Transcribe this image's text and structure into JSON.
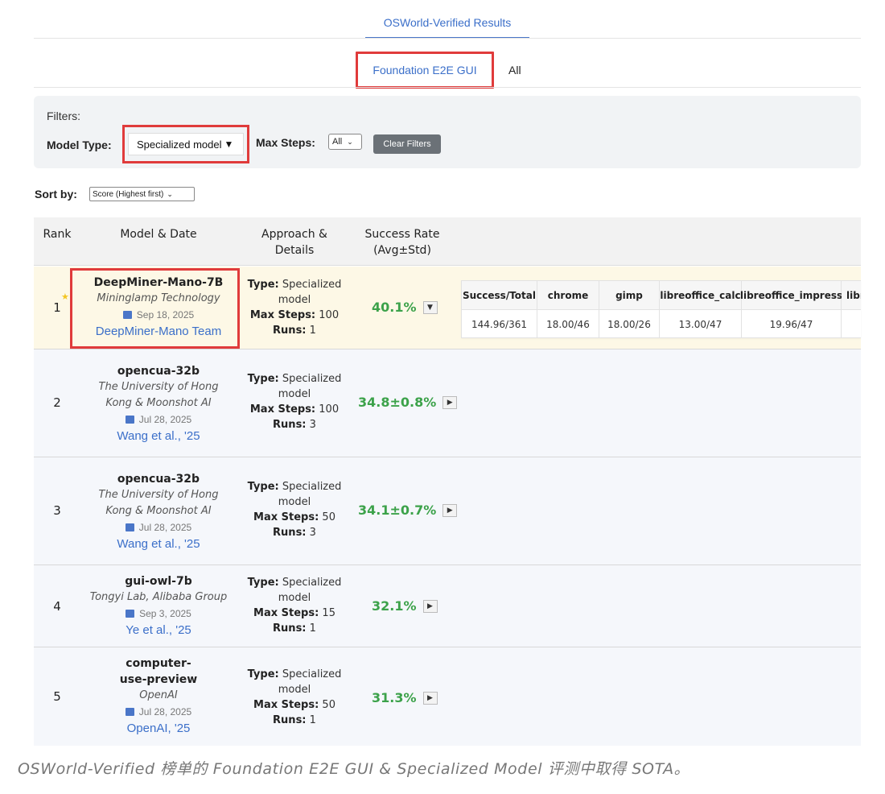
{
  "top_tab": "OSWorld-Verified Results",
  "sub_tabs": {
    "active": "Foundation E2E GUI",
    "other": "All"
  },
  "filters": {
    "label": "Filters:",
    "model_type_label": "Model Type:",
    "model_type_value": "Specialized model",
    "model_type_arrow": "▼",
    "max_steps_label": "Max Steps:",
    "max_steps_value": "All",
    "clear_label": "Clear Filters"
  },
  "sort": {
    "label": "Sort by:",
    "value": "Score (Highest first)"
  },
  "table": {
    "headers": {
      "rank": "Rank",
      "model": "Model & Date",
      "approach_l1": "Approach &",
      "approach_l2": "Details",
      "rate_l1": "Success Rate",
      "rate_l2": "(Avg±Std)"
    },
    "labels": {
      "type": "Type:",
      "max_steps": "Max Steps:",
      "runs": "Runs:"
    },
    "rows": [
      {
        "rank": "1",
        "star": "★",
        "name": "DeepMiner-Mano-7B",
        "org": "Mininglamp Technology",
        "date": "Sep 18, 2025",
        "author": "DeepMiner-Mano Team",
        "type": "Specialized model",
        "max_steps": "100",
        "runs": "1",
        "rate": "40.1%",
        "toggle": "▼"
      },
      {
        "rank": "2",
        "name": "opencua-32b",
        "org": "The University of Hong Kong & Moonshot AI",
        "date": "Jul 28, 2025",
        "author": "Wang et al., '25",
        "type": "Specialized model",
        "max_steps": "100",
        "runs": "3",
        "rate": "34.8±0.8%",
        "toggle": "▶"
      },
      {
        "rank": "3",
        "name": "opencua-32b",
        "org": "The University of Hong Kong & Moonshot AI",
        "date": "Jul 28, 2025",
        "author": "Wang et al., '25",
        "type": "Specialized model",
        "max_steps": "50",
        "runs": "3",
        "rate": "34.1±0.7%",
        "toggle": "▶"
      },
      {
        "rank": "4",
        "name": "gui-owl-7b",
        "org": "Tongyi Lab, Alibaba Group",
        "date": "Sep 3, 2025",
        "author": "Ye et al., '25",
        "type": "Specialized model",
        "max_steps": "15",
        "runs": "1",
        "rate": "32.1%",
        "toggle": "▶"
      },
      {
        "rank": "5",
        "name": "computer-use-preview",
        "org": "OpenAI",
        "date": "Jul 28, 2025",
        "author": "OpenAI, '25",
        "type": "Specialized model",
        "max_steps": "50",
        "runs": "1",
        "rate": "31.3%",
        "toggle": "▶"
      }
    ]
  },
  "detail": {
    "headers": [
      "Success/Total",
      "chrome",
      "gimp",
      "libreoffice_calc",
      "libreoffice_impress",
      "libr"
    ],
    "values": [
      "144.96/361",
      "18.00/46",
      "18.00/26",
      "13.00/47",
      "19.96/47",
      ""
    ]
  },
  "caption": "OSWorld-Verified 榜单的 Foundation E2E GUI & Specialized Model 评测中取得 SOTA。",
  "colors": {
    "accent": "#3b6fc9",
    "highlight": "#e03b3b",
    "success": "#3ca24a",
    "first_row": "#fdf8e6"
  }
}
